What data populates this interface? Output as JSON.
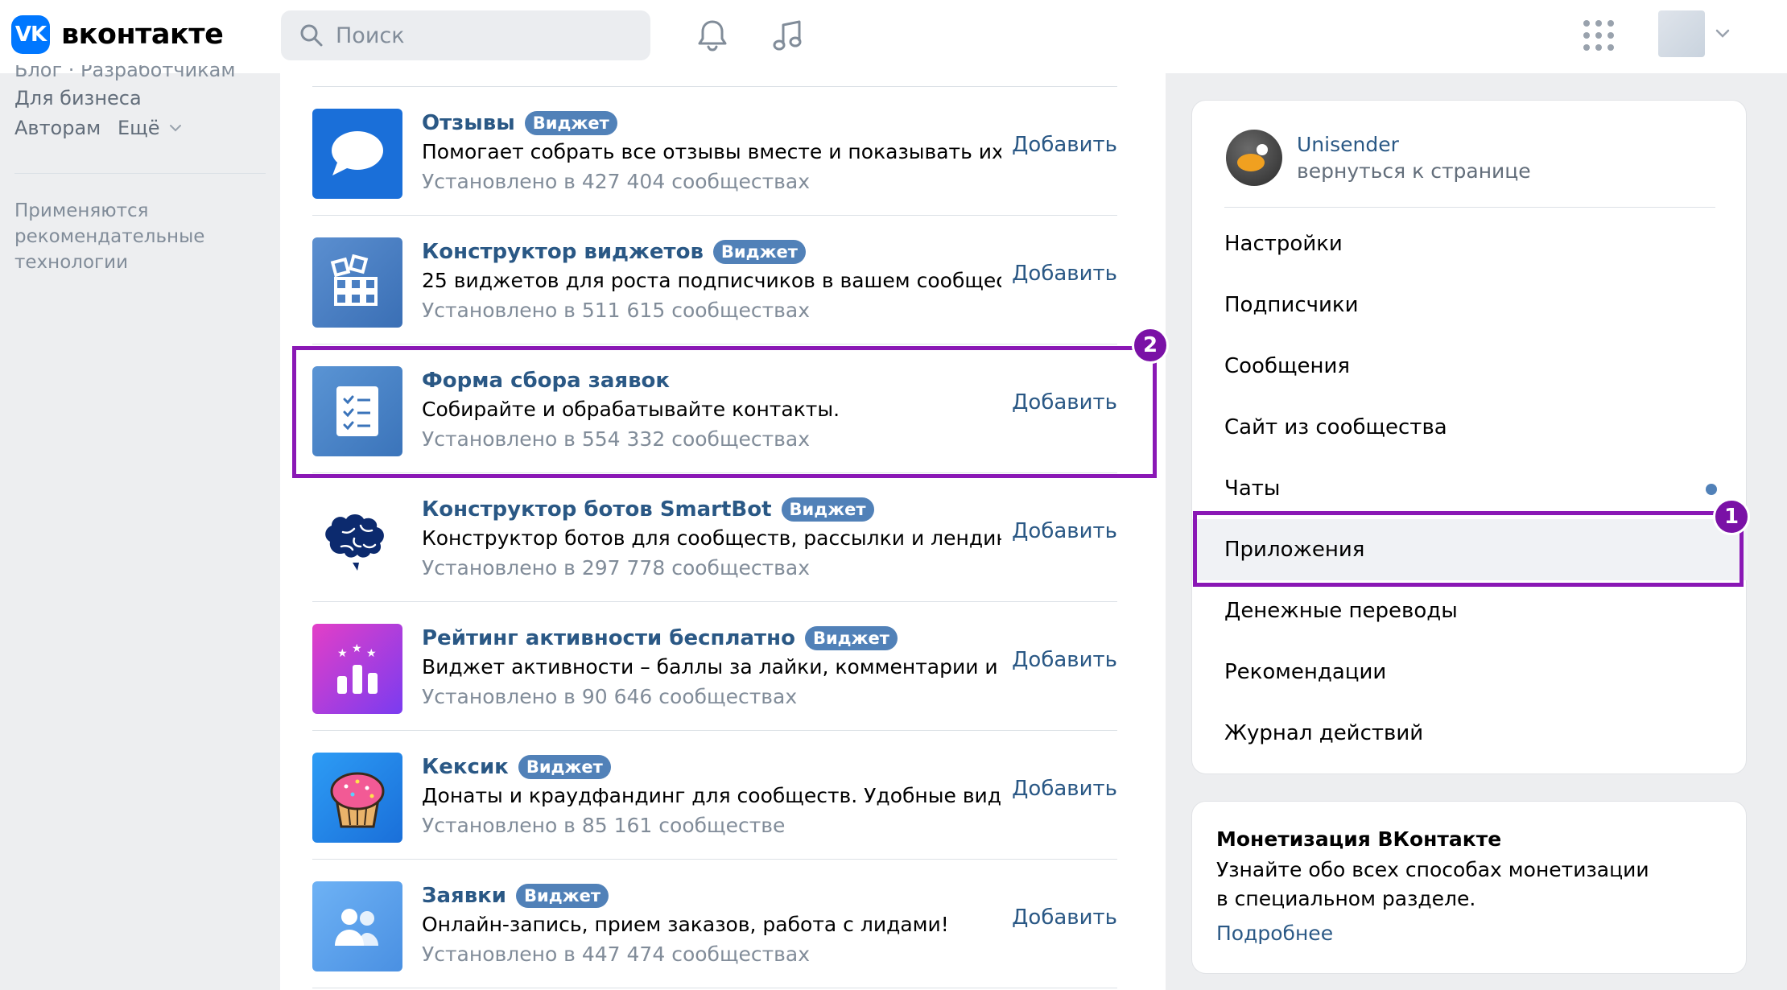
{
  "header": {
    "logo_badge": "VK",
    "logo_text": "вконтакте",
    "search_placeholder": "Поиск",
    "icons": [
      "search-icon",
      "bell-icon",
      "music-icon",
      "apps-grid-icon",
      "chevron-down-icon"
    ]
  },
  "left": {
    "clipped_line": "Блог · Разработчикам",
    "links": [
      "Для бизнеса",
      "Авторам",
      "Ещё"
    ],
    "note": "Применяются рекомендательные технологии"
  },
  "apps": [
    {
      "title": "Отзывы",
      "badge": "Виджет",
      "desc": "Помогает собрать все отзывы вместе и показывать их ...",
      "count": "Установлено в 427 404 сообществах",
      "action": "Добавить",
      "icon": "speech-bubble-icon",
      "color": "#1a6fd9"
    },
    {
      "title": "Конструктор виджетов",
      "badge": "Виджет",
      "desc": "25 виджетов для роста подписчиков в вашем сообщес...",
      "count": "Установлено в 511 615 сообществах",
      "action": "Добавить",
      "icon": "widget-grid-icon",
      "color": "#4a7ec2"
    },
    {
      "title": "Форма сбора заявок",
      "badge": "",
      "desc": "Собирайте и обрабатывайте контакты.",
      "count": "Установлено в 554 332 сообществах",
      "action": "Добавить",
      "icon": "form-checklist-icon",
      "color": "#4a86c8"
    },
    {
      "title": "Конструктор ботов SmartBot",
      "badge": "Виджет",
      "desc": "Конструктор ботов для сообществ, рассылки и лендин...",
      "count": "Установлено в 297 778 сообществах",
      "action": "Добавить",
      "icon": "brain-icon",
      "color": "#ffffff"
    },
    {
      "title": "Рейтинг активности бесплатно",
      "badge": "Виджет",
      "desc": "Виджет активности – баллы за лайки, комментарии и ...",
      "count": "Установлено в 90 646 сообществах",
      "action": "Добавить",
      "icon": "rating-chart-icon",
      "color": "#a03ce0"
    },
    {
      "title": "Кексик",
      "badge": "Виджет",
      "desc": "Донаты и краудфандинг для сообществ. Удобные вид...",
      "count": "Установлено в 85 161 сообществе",
      "action": "Добавить",
      "icon": "cupcake-icon",
      "color": "#2a8ef5"
    },
    {
      "title": "Заявки",
      "badge": "Виджет",
      "desc": "Онлайн-запись, прием заказов, работа с лидами!",
      "count": "Установлено в 447 474 сообществах",
      "action": "Добавить",
      "icon": "users-icon",
      "color": "#5aa3ef"
    }
  ],
  "group": {
    "name": "Unisender",
    "sub": "вернуться к странице"
  },
  "menu": [
    "Настройки",
    "Подписчики",
    "Сообщения",
    "Сайт из сообщества",
    "Чаты",
    "Приложения",
    "Денежные переводы",
    "Рекомендации",
    "Журнал действий"
  ],
  "annotations": {
    "first": "1",
    "second": "2",
    "color": "#8a18b5"
  },
  "promo": {
    "title": "Монетизация ВКонтакте",
    "text": "Узнайте обо всех способах монетизации в специальном разделе.",
    "link": "Подробнее"
  }
}
